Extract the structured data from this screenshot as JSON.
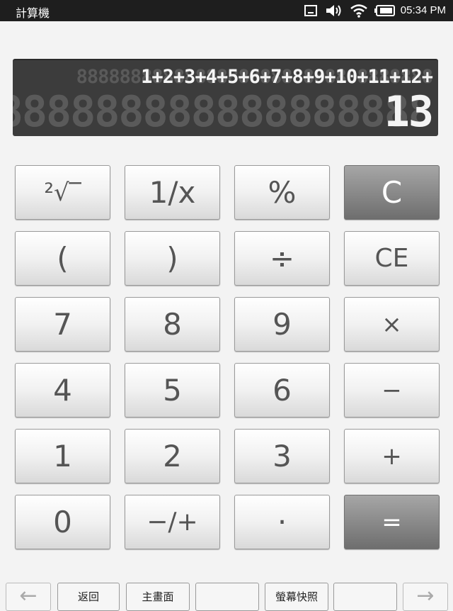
{
  "status_bar": {
    "app_title": "計算機",
    "time": "05:34 PM",
    "icons": [
      "notification-icon",
      "volume-icon",
      "wifi-icon",
      "battery-icon"
    ]
  },
  "display": {
    "expression": "1+2+3+4+5+6+7+8+9+10+11+12+",
    "expression_ghost": "888888888888888888888888888888888",
    "result": "13",
    "result_ghost": "8888888888888888888"
  },
  "keys": {
    "root": "²√‾",
    "reciprocal": "1/x",
    "percent": "%",
    "clear": "C",
    "open_paren": "(",
    "close_paren": ")",
    "divide": "÷",
    "clear_entry": "CE",
    "seven": "7",
    "eight": "8",
    "nine": "9",
    "multiply": "×",
    "four": "4",
    "five": "5",
    "six": "6",
    "subtract": "−",
    "one": "1",
    "two": "2",
    "three": "3",
    "add": "+",
    "zero": "0",
    "negate": "−/+",
    "decimal": "·",
    "equals": "="
  },
  "nav": {
    "back_arrow": "←",
    "back": "返回",
    "home": "主畫面",
    "blank": "",
    "screenshot": "螢幕快照",
    "blank2": "",
    "forward_arrow": "→"
  },
  "colors": {
    "status_bar_bg": "#1e1e1e",
    "display_bg": "#3c3c3c",
    "accent_key": "#8a8a8a"
  }
}
